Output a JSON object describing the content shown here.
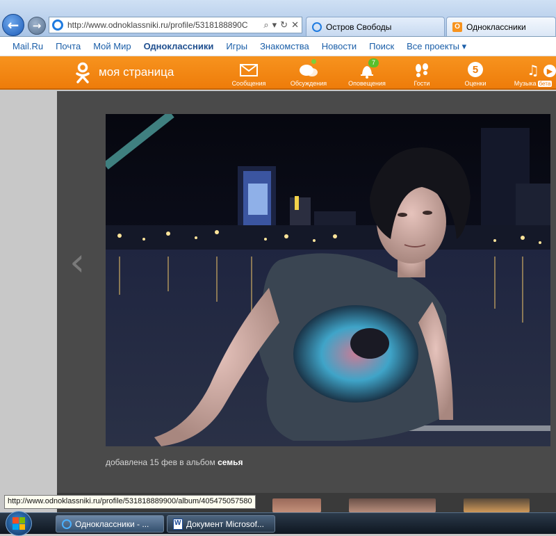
{
  "browser": {
    "url": "http://www.odnoklassniki.ru/profile/531818889900/album/405475057580",
    "url_visible": "http://www.odnoklassniki.ru/profile/5318188890С",
    "tabs": [
      {
        "label": "Остров Свободы",
        "icon": "ie-icon"
      },
      {
        "label": "Одноклассники",
        "icon": "ok-icon"
      }
    ]
  },
  "mail_nav": {
    "items": [
      "Mail.Ru",
      "Почта",
      "Мой Мир",
      "Одноклассники",
      "Игры",
      "Знакомства",
      "Новости",
      "Поиск",
      "Все проекты ▾"
    ]
  },
  "ok_header": {
    "title": "моя страница",
    "menu": [
      {
        "label": "Сообщения",
        "icon": "envelope-icon"
      },
      {
        "label": "Обсуждения",
        "icon": "chat-icon"
      },
      {
        "label": "Оповещения",
        "icon": "bell-icon",
        "badge": "7"
      },
      {
        "label": "Гости",
        "icon": "footprints-icon"
      },
      {
        "label": "Оценки",
        "icon": "rating-icon",
        "glyph": "5"
      },
      {
        "label": "Музыка",
        "icon": "music-icon",
        "tag": "бета"
      }
    ]
  },
  "photo": {
    "caption_prefix": "добавлена 15 фев в альбом",
    "album": "семья"
  },
  "status_tip": "http://www.odnoklassniki.ru/profile/531818889900/album/405475057580",
  "taskbar": {
    "items": [
      {
        "label": "Одноклассники - ...",
        "icon": "ie-icon"
      },
      {
        "label": "Документ Microsof...",
        "icon": "word-doc-icon"
      }
    ]
  },
  "colors": {
    "ok_orange": "#f7931e",
    "viewer_bg": "#4a4a4a",
    "link_blue": "#1a5ea8"
  }
}
